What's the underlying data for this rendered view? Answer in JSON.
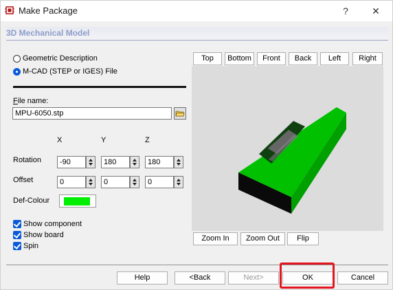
{
  "window": {
    "title": "Make Package",
    "help_glyph": "?",
    "close_glyph": "✕"
  },
  "section": {
    "title": "3D Mechanical Model"
  },
  "source_options": [
    {
      "label": "Geometric Description",
      "selected": false
    },
    {
      "label": "M-CAD (STEP or IGES) File",
      "selected": true
    }
  ],
  "file": {
    "label": "File name:",
    "value": "MPU-6050.stp"
  },
  "axes": {
    "x": "X",
    "y": "Y",
    "z": "Z"
  },
  "rotation": {
    "label": "Rotation",
    "x": "-90",
    "y": "180",
    "z": "180"
  },
  "offset": {
    "label": "Offset",
    "x": "0",
    "y": "0",
    "z": "0"
  },
  "def_colour": {
    "label": "Def-Colour",
    "color": "#00ee00"
  },
  "checkboxes": [
    {
      "label": "Show component",
      "checked": true
    },
    {
      "label": "Show board",
      "checked": true
    },
    {
      "label": "Spin",
      "checked": true
    }
  ],
  "view_buttons": [
    "Top",
    "Bottom",
    "Front",
    "Back",
    "Left",
    "Right"
  ],
  "zoom_buttons": [
    "Zoom In",
    "Zoom Out",
    "Flip"
  ],
  "footer_buttons": {
    "help": "Help",
    "back": "<Back",
    "next": "Next>",
    "ok": "OK",
    "cancel": "Cancel"
  },
  "colors": {
    "section_title": "#8d9ec8",
    "accent": "#0a5bd8",
    "highlight": "#e4141e",
    "package_green": "#00c000"
  }
}
